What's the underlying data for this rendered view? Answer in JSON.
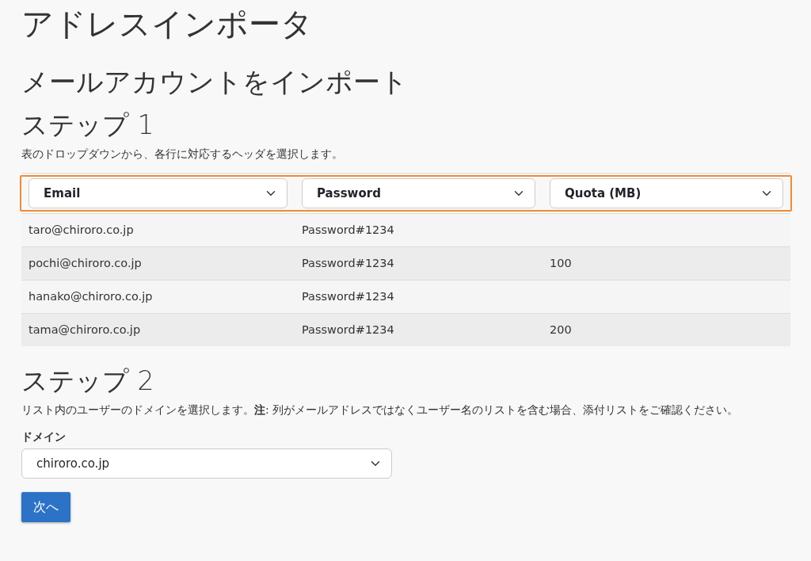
{
  "title": "アドレスインポータ",
  "subtitle": "メールアカウントをインポート",
  "step1": {
    "heading": "ステップ 1",
    "description": "表のドロップダウンから、各行に対応するヘッダを選択します。",
    "header_selects": [
      {
        "value": "Email"
      },
      {
        "value": "Password"
      },
      {
        "value": "Quota (MB)"
      }
    ],
    "highlighted": true,
    "rows": [
      [
        "taro@chiroro.co.jp",
        "Password#1234",
        ""
      ],
      [
        "pochi@chiroro.co.jp",
        "Password#1234",
        "100"
      ],
      [
        "hanako@chiroro.co.jp",
        "Password#1234",
        ""
      ],
      [
        "tama@chiroro.co.jp",
        "Password#1234",
        "200"
      ]
    ]
  },
  "step2": {
    "heading": "ステップ 2",
    "description": "リスト内のユーザーのドメインを選択します。**注**: 列がメールアドレスではなくユーザー名のリストを含む場合、添付リストをご確認ください。",
    "domain_label": "ドメイン",
    "domain_value": "chiroro.co.jp"
  },
  "next_button": "次へ"
}
